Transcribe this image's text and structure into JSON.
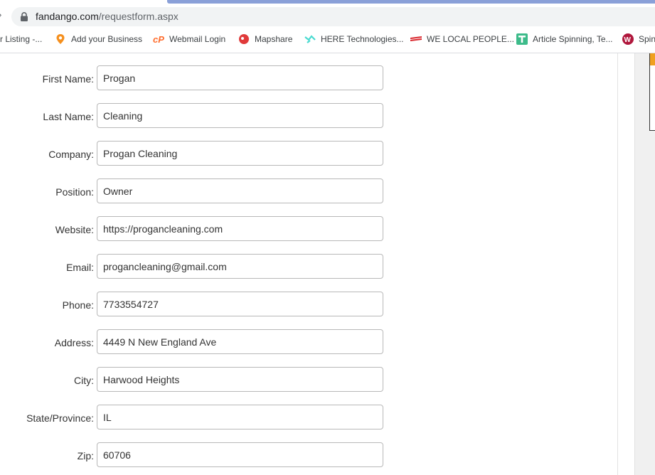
{
  "browser": {
    "url_domain": "fandango.com",
    "url_path": "/requestform.aspx",
    "bookmarks": [
      {
        "label": "r Listing -...",
        "icon": "listing-icon",
        "color": "#888888"
      },
      {
        "label": "Add your Business",
        "icon": "map-pin-icon",
        "color": "#f5901e"
      },
      {
        "label": "Webmail Login",
        "icon": "cpanel-icon",
        "color": "#ff6c2c"
      },
      {
        "label": "Mapshare",
        "icon": "mapshare-icon",
        "color": "#e03a3a"
      },
      {
        "label": "HERE Technologies...",
        "icon": "here-icon",
        "color": "#48dad0"
      },
      {
        "label": "WE LOCAL PEOPLE...",
        "icon": "we-local-icon",
        "color": "#d9262c"
      },
      {
        "label": "Article Spinning, Te...",
        "icon": "t-icon",
        "color": "#3dbb8a"
      },
      {
        "label": "Spin",
        "icon": "w-icon",
        "color": "#b0173c"
      }
    ]
  },
  "form": {
    "fields": [
      {
        "label": "First Name:",
        "value": "Progan"
      },
      {
        "label": "Last Name:",
        "value": "Cleaning"
      },
      {
        "label": "Company:",
        "value": "Progan Cleaning"
      },
      {
        "label": "Position:",
        "value": "Owner"
      },
      {
        "label": "Website:",
        "value": "https://progancleaning.com"
      },
      {
        "label": "Email:",
        "value": "progancleaning@gmail.com"
      },
      {
        "label": "Phone:",
        "value": "7733554727"
      },
      {
        "label": "Address:",
        "value": "4449 N New England Ave"
      },
      {
        "label": "City:",
        "value": "Harwood Heights"
      },
      {
        "label": "State/Province:",
        "value": "IL"
      },
      {
        "label": "Zip:",
        "value": "60706"
      }
    ]
  }
}
